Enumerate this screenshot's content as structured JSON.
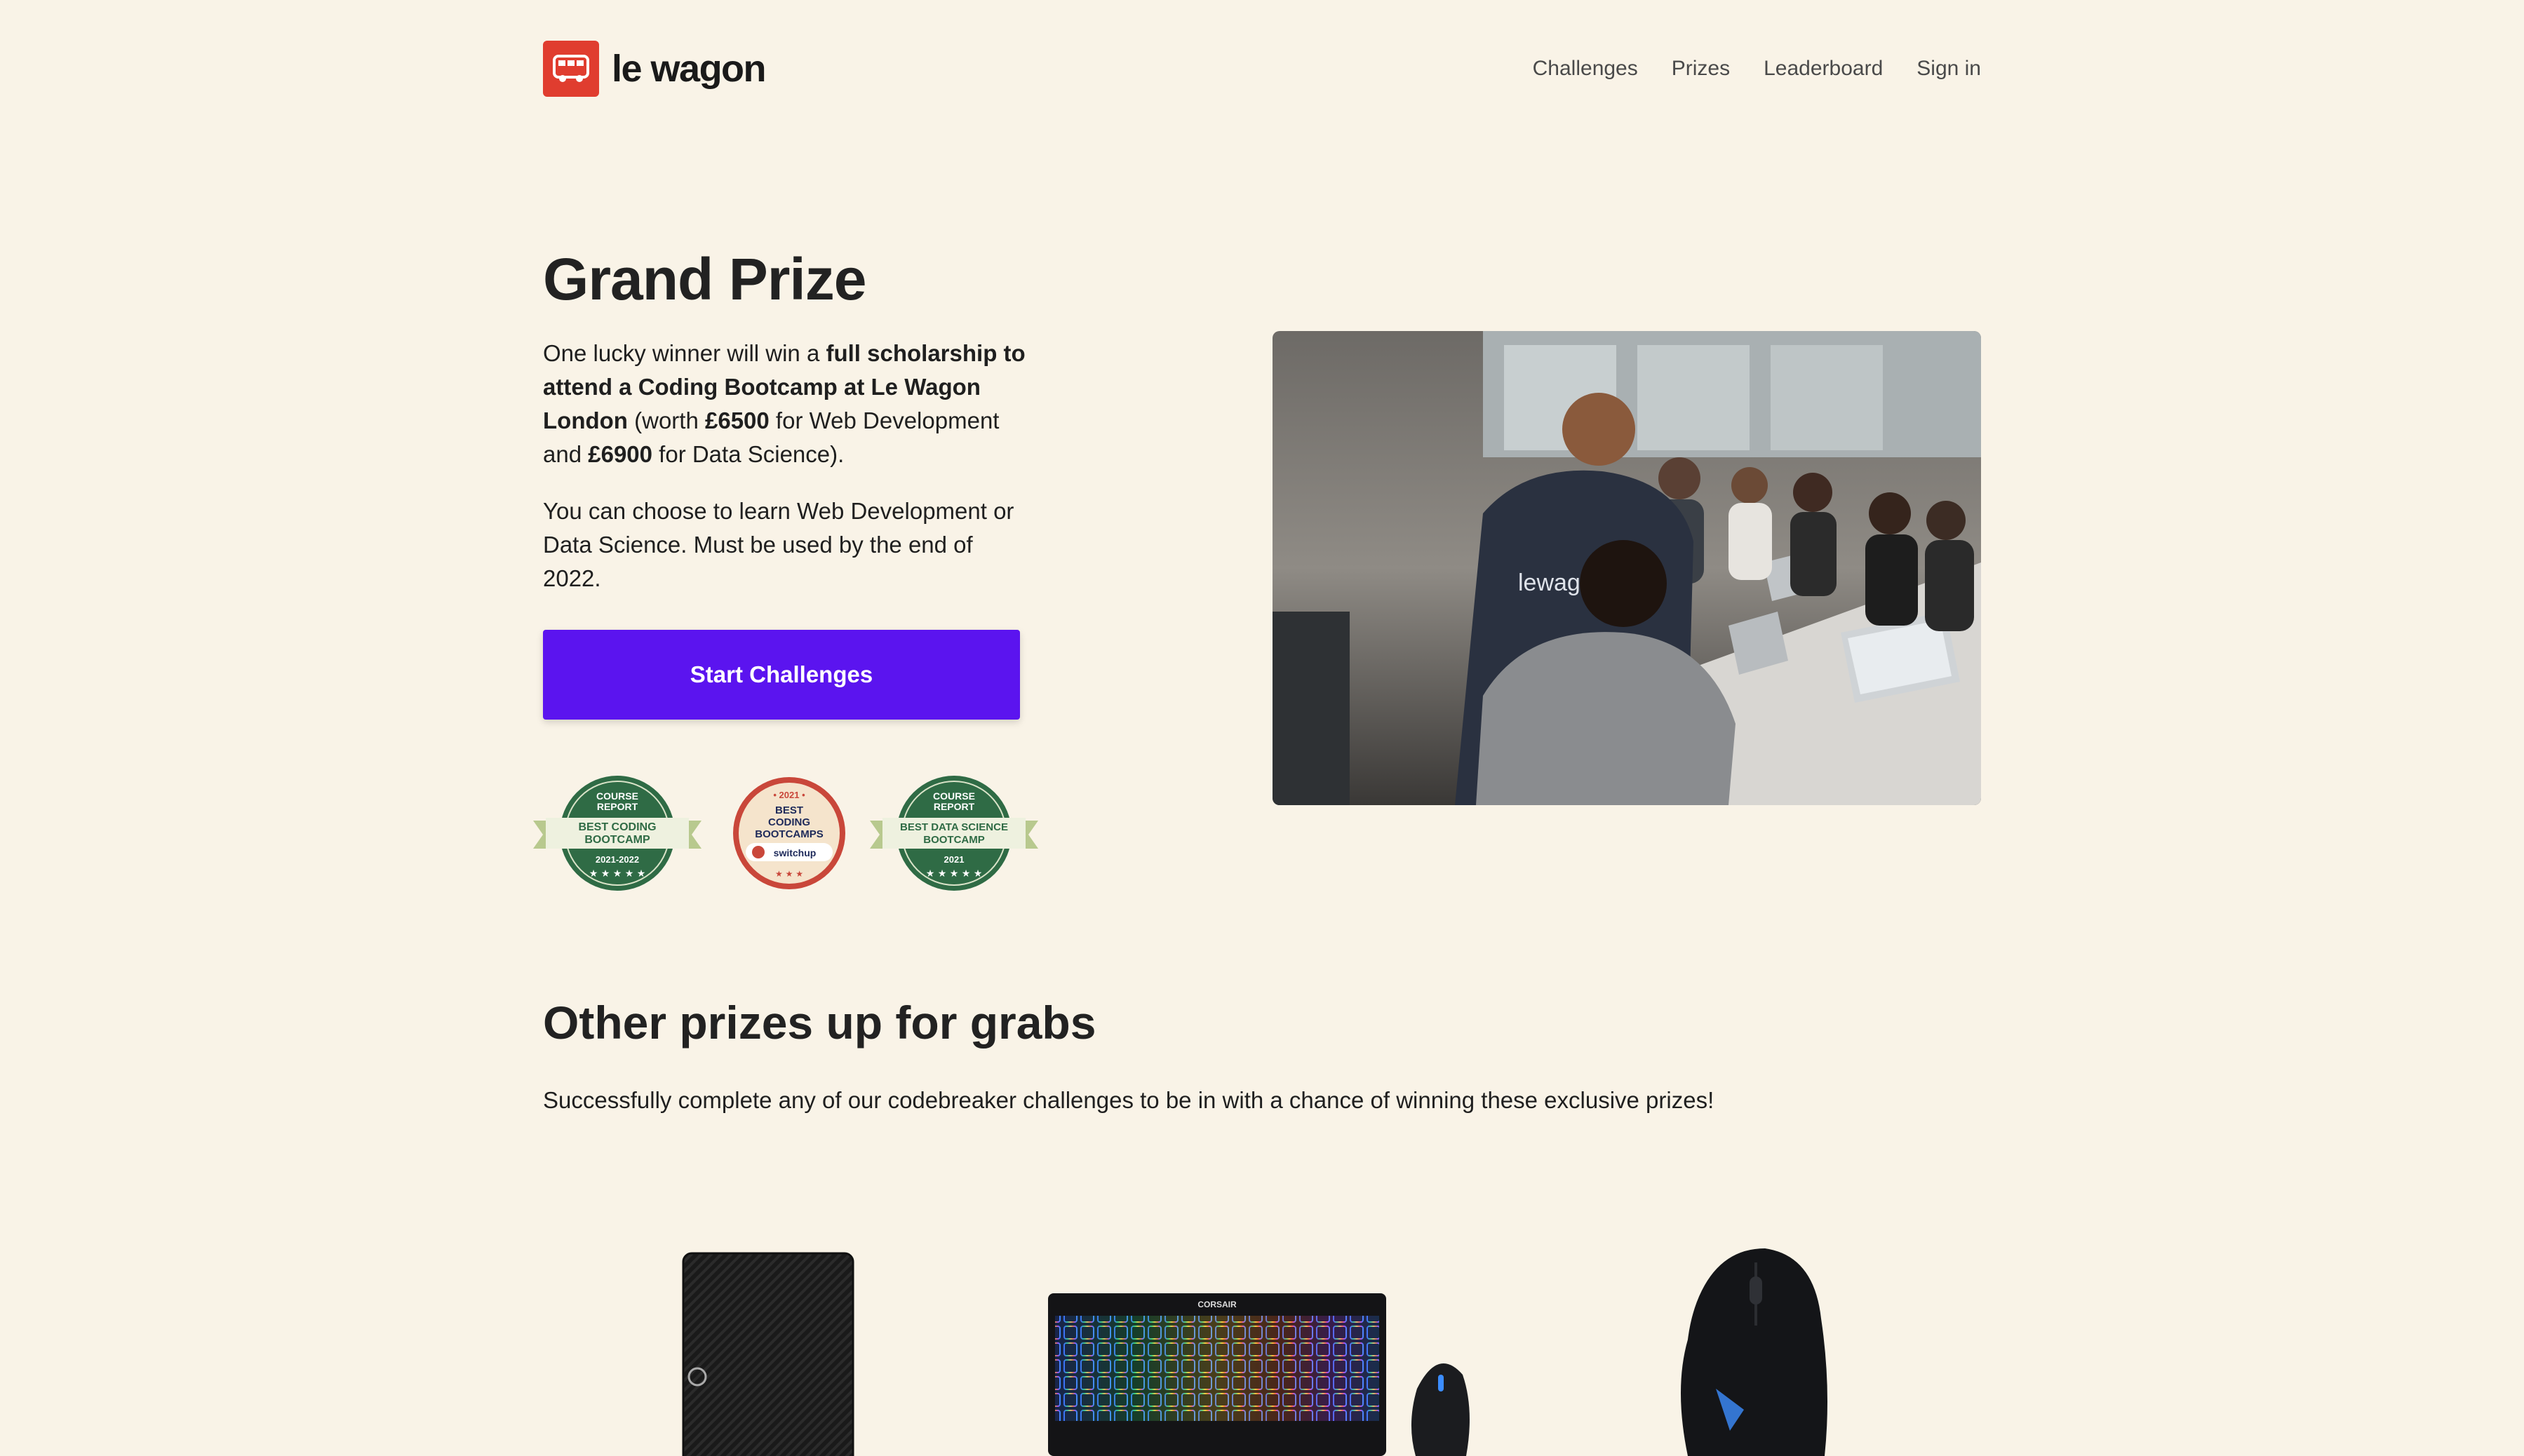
{
  "header": {
    "logo_text": "le wagon",
    "logo_icon": "bus-icon",
    "nav": [
      {
        "label": "Challenges"
      },
      {
        "label": "Prizes"
      },
      {
        "label": "Leaderboard"
      },
      {
        "label": "Sign in"
      }
    ]
  },
  "hero": {
    "title": "Grand Prize",
    "p1_a": "One lucky winner will win a ",
    "p1_b": "full scholarship to attend a Coding Bootcamp at Le Wagon London",
    "p1_c": " (worth ",
    "p1_d": "£6500",
    "p1_e": " for Web Development and ",
    "p1_f": "£6900",
    "p1_g": " for Data Science).",
    "p2": "You can choose to learn Web Development or Data Science. Must be used by the end of 2022.",
    "cta_label": "Start Challenges",
    "badges": [
      {
        "top": "COURSE",
        "top2": "REPORT",
        "main1": "BEST CODING",
        "main2": "BOOTCAMP",
        "year": "2021-2022"
      },
      {
        "year": "• 2021 •",
        "main1": "BEST",
        "main2": "CODING",
        "main3": "BOOTCAMPS",
        "brand": "switchup"
      },
      {
        "top": "COURSE",
        "top2": "REPORT",
        "main1": "BEST DATA SCIENCE",
        "main2": "BOOTCAMP",
        "year": "2021"
      }
    ],
    "photo_shirt_text": "lewagon"
  },
  "other": {
    "title": "Other prizes up for grabs",
    "subtitle": "Successfully complete any of our codebreaker challenges to be in with a chance of winning these exclusive prizes!"
  },
  "prizes": [
    {
      "icon": "external-hard-drive-icon"
    },
    {
      "icon": "keyboard-and-mouse-icon",
      "brand": "CORSAIR"
    },
    {
      "icon": "gaming-mouse-icon"
    }
  ],
  "colors": {
    "background": "#f9f3e7",
    "brand_red": "#e03d2f",
    "cta_purple": "#5b14ef",
    "badge_green": "#2f6b45",
    "badge_red": "#c9473a"
  }
}
